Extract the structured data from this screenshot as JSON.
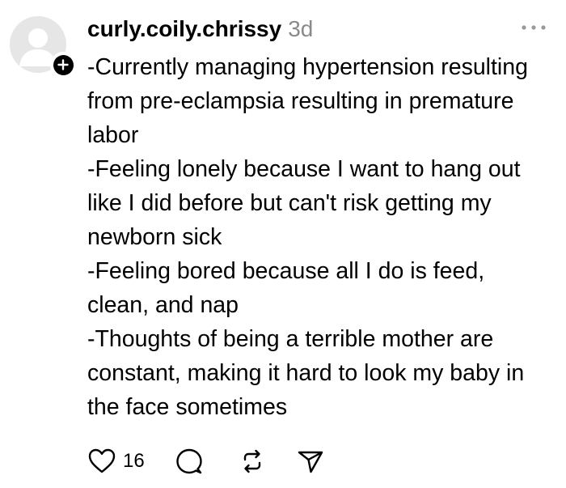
{
  "post": {
    "username": "curly.coily.chrissy",
    "timestamp": "3d",
    "body_lines": [
      "-Currently managing hypertension resulting",
      "from pre-eclampsia resulting in premature",
      "labor",
      "-Feeling lonely because I want to hang out",
      "like I did before but can't risk getting my",
      "newborn sick",
      "-Feeling bored because all I do is feed,",
      "clean, and nap",
      "-Thoughts of being a terrible mother are",
      "constant, making it hard to look my baby in",
      "the face sometimes"
    ],
    "like_count": "16"
  },
  "icons": {
    "avatar": "default-avatar-icon",
    "follow": "plus-icon",
    "more": "more-horizontal-icon",
    "like": "heart-icon",
    "reply": "comment-icon",
    "repost": "repost-icon",
    "share": "send-icon"
  }
}
